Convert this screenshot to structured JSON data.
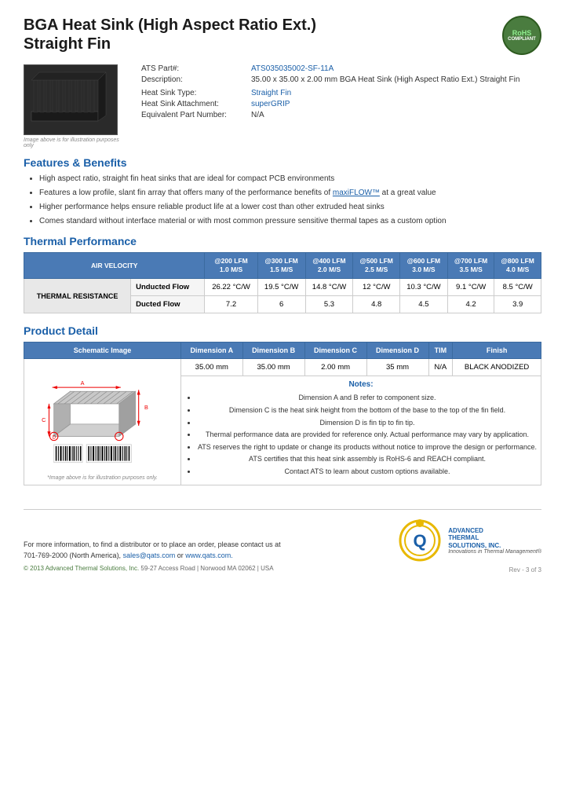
{
  "header": {
    "title_line1": "BGA Heat Sink (High Aspect Ratio Ext.)",
    "title_line2": "Straight Fin",
    "rohs": "RoHS\nCompliant"
  },
  "product": {
    "part_label": "ATS Part#:",
    "part_number": "ATS035035002-SF-11A",
    "description_label": "Description:",
    "description": "35.00 x 35.00 x 2.00 mm  BGA Heat Sink (High Aspect Ratio Ext.) Straight Fin",
    "heat_sink_type_label": "Heat Sink Type:",
    "heat_sink_type": "Straight Fin",
    "attachment_label": "Heat Sink Attachment:",
    "attachment": "superGRIP",
    "equiv_part_label": "Equivalent Part Number:",
    "equiv_part": "N/A",
    "image_caption": "Image above is for illustration purposes only"
  },
  "features": {
    "section_title": "Features & Benefits",
    "items": [
      "High aspect ratio, straight fin heat sinks that are ideal for compact PCB environments",
      "Features a low profile, slant fin array that offers many of the performance benefits of maxiFLOW™ at a great value",
      "Higher performance helps ensure reliable product life at a lower cost than other extruded heat sinks",
      "Comes standard without interface material or with most common pressure sensitive thermal tapes as a custom option"
    ]
  },
  "thermal": {
    "section_title": "Thermal Performance",
    "col_header_label": "AIR VELOCITY",
    "columns": [
      {
        "lfm": "@200 LFM",
        "ms": "1.0 M/S"
      },
      {
        "lfm": "@300 LFM",
        "ms": "1.5 M/S"
      },
      {
        "lfm": "@400 LFM",
        "ms": "2.0 M/S"
      },
      {
        "lfm": "@500 LFM",
        "ms": "2.5 M/S"
      },
      {
        "lfm": "@600 LFM",
        "ms": "3.0 M/S"
      },
      {
        "lfm": "@700 LFM",
        "ms": "3.5 M/S"
      },
      {
        "lfm": "@800 LFM",
        "ms": "4.0 M/S"
      }
    ],
    "row_label": "THERMAL RESISTANCE",
    "rows": [
      {
        "label": "Unducted Flow",
        "values": [
          "26.22 °C/W",
          "19.5 °C/W",
          "14.8 °C/W",
          "12 °C/W",
          "10.3 °C/W",
          "9.1 °C/W",
          "8.5 °C/W"
        ]
      },
      {
        "label": "Ducted Flow",
        "values": [
          "7.2",
          "6",
          "5.3",
          "4.8",
          "4.5",
          "4.2",
          "3.9"
        ]
      }
    ]
  },
  "product_detail": {
    "section_title": "Product Detail",
    "columns": [
      "Schematic Image",
      "Dimension A",
      "Dimension B",
      "Dimension C",
      "Dimension D",
      "TIM",
      "Finish"
    ],
    "values": [
      "35.00 mm",
      "35.00 mm",
      "2.00 mm",
      "35 mm",
      "N/A",
      "BLACK ANODIZED"
    ],
    "notes_title": "Notes:",
    "notes": [
      "Dimension A and B refer to component size.",
      "Dimension C is the heat sink height from the bottom of the base to the top of the fin field.",
      "Dimension D is fin tip to fin tip.",
      "Thermal performance data are provided for reference only. Actual performance may vary by application.",
      "ATS reserves the right to update or change its products without notice to improve the design or performance.",
      "ATS certifies that this heat sink assembly is RoHS-6 and REACH compliant.",
      "Contact ATS to learn about custom options available."
    ],
    "schematic_caption": "*Image above is for illustration purposes only."
  },
  "footer": {
    "contact_text": "For more information, to find a distributor or to place an order, please contact us at\n701-769-2000 (North America),",
    "email": "sales@qats.com",
    "or_text": "or",
    "website": "www.qats.com.",
    "copyright": "© 2013 Advanced Thermal Solutions, Inc.",
    "address": "59-27 Access Road  |  Norwood MA  02062  |  USA",
    "company_name_line1": "ADVANCED",
    "company_name_line2": "THERMAL",
    "company_name_line3": "SOLUTIONS, INC.",
    "tagline": "Innovations in Thermal Management®",
    "page_number": "Rev - 3 of 3"
  }
}
